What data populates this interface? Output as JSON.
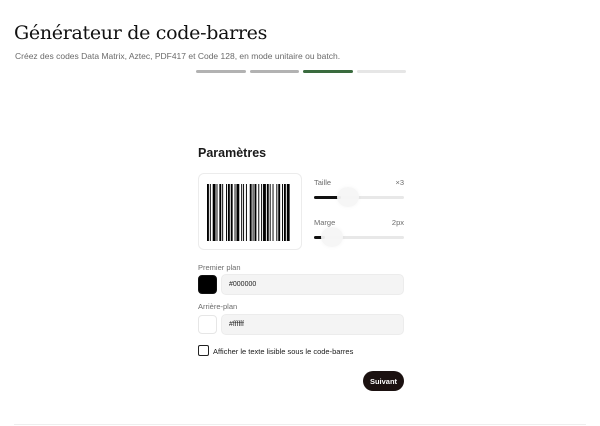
{
  "header": {
    "title": "Générateur de code-barres",
    "subtitle": "Créez des codes Data Matrix, Aztec, PDF417 et Code 128, en mode unitaire ou batch."
  },
  "stepper": {
    "steps": [
      "done",
      "done",
      "active",
      "pending"
    ]
  },
  "settings": {
    "title": "Paramètres",
    "size": {
      "label": "Taille",
      "value": "×3",
      "level": 0.3
    },
    "margin": {
      "label": "Marge",
      "value": "2px",
      "level": 0.12
    },
    "foreground": {
      "label": "Premier plan",
      "value": "#000000",
      "color": "#000000"
    },
    "background": {
      "label": "Arrière-plan",
      "value": "#ffffff",
      "color": "#ffffff"
    },
    "show_text": {
      "label": "Afficher le texte lisible sous le code-barres",
      "checked": false
    }
  },
  "actions": {
    "next_label": "Suivant"
  }
}
